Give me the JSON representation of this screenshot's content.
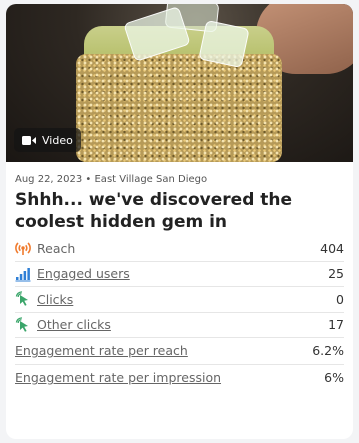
{
  "media": {
    "badge_label": "Video",
    "badge_icon": "video-camera-icon"
  },
  "post": {
    "meta": "Aug 22, 2023 • East Village San Diego",
    "title": "Shhh... we've discovered the coolest hidden gem in #EastVillageSD! 🍸..."
  },
  "metrics": [
    {
      "icon": "reach-icon",
      "label": "Reach",
      "value": "404",
      "underlined": false
    },
    {
      "icon": "bar-chart-icon",
      "label": "Engaged users",
      "value": "25",
      "underlined": true
    },
    {
      "icon": "cursor-click-icon",
      "label": "Clicks",
      "value": "0",
      "underlined": true
    },
    {
      "icon": "cursor-click-icon",
      "label": "Other clicks",
      "value": "17",
      "underlined": true
    },
    {
      "icon": "",
      "label": "Engagement rate per reach",
      "value": "6.2%",
      "underlined": true
    },
    {
      "icon": "",
      "label": "Engagement rate per impression",
      "value": "6%",
      "underlined": true
    }
  ],
  "colors": {
    "reach_icon": "#f07b2e",
    "bar_icon": "#2f7fd6",
    "click_icon": "#3aa56a"
  }
}
